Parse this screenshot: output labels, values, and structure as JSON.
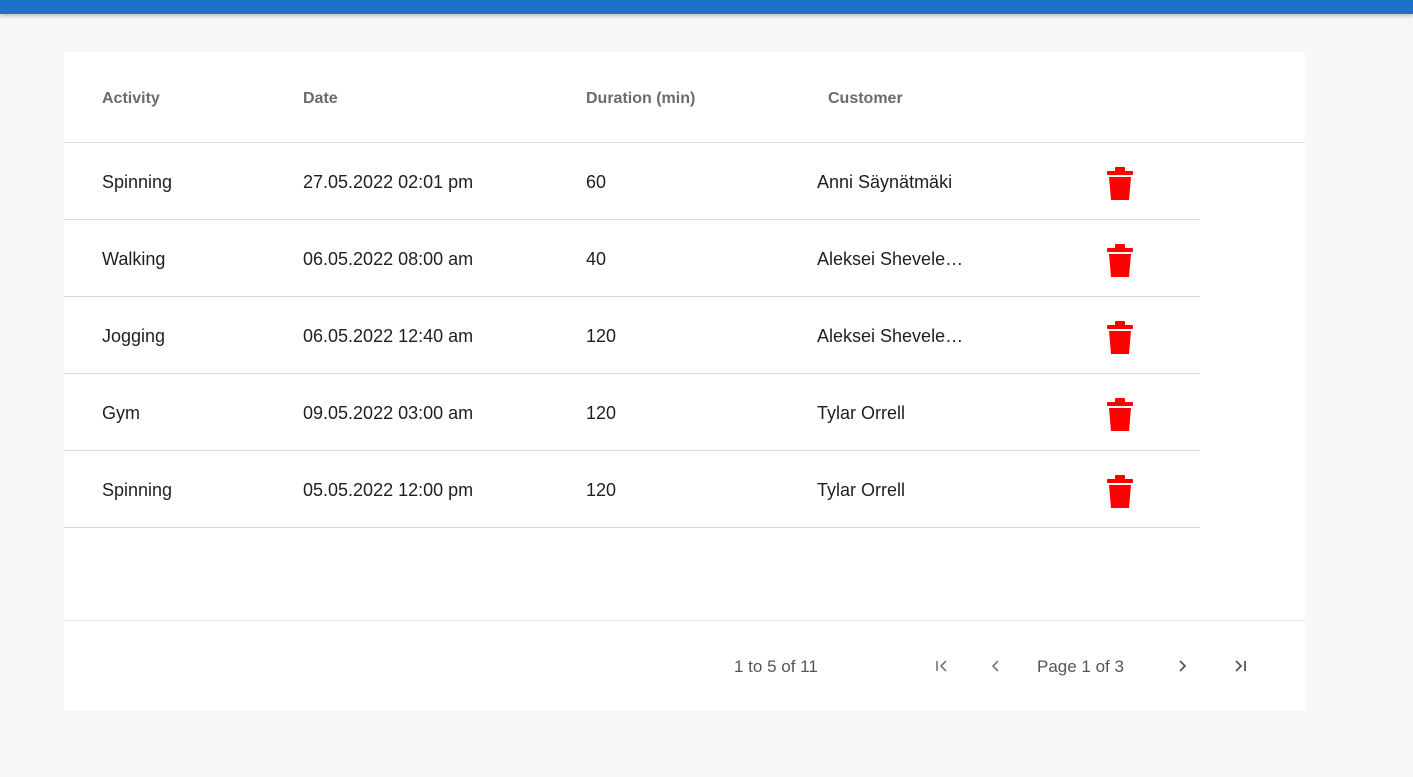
{
  "colors": {
    "topbar": "#1a73c8",
    "delete_icon": "#ff0000"
  },
  "columns": {
    "activity": "Activity",
    "date": "Date",
    "duration": "Duration (min)",
    "customer": "Customer"
  },
  "rows": [
    {
      "activity": "Spinning",
      "date": "27.05.2022 02:01 pm",
      "duration": "60",
      "customer": "Anni Säynätmäki",
      "action_icon": "trash-icon"
    },
    {
      "activity": "Walking",
      "date": "06.05.2022 08:00 am",
      "duration": "40",
      "customer": "Aleksei Shevele…",
      "action_icon": "trash-icon"
    },
    {
      "activity": "Jogging",
      "date": "06.05.2022 12:40 am",
      "duration": "120",
      "customer": "Aleksei Shevele…",
      "action_icon": "trash-icon"
    },
    {
      "activity": "Gym",
      "date": "09.05.2022 03:00 am",
      "duration": "120",
      "customer": "Tylar Orrell",
      "action_icon": "trash-icon"
    },
    {
      "activity": "Spinning",
      "date": "05.05.2022 12:00 pm",
      "duration": "120",
      "customer": "Tylar Orrell",
      "action_icon": "trash-icon"
    }
  ],
  "pagination": {
    "summary": "1 to 5 of 11",
    "page_label": "Page 1 of 3",
    "icons": {
      "first": "first-page-icon",
      "previous": "chevron-left-icon",
      "next": "chevron-right-icon",
      "last": "last-page-icon"
    }
  }
}
